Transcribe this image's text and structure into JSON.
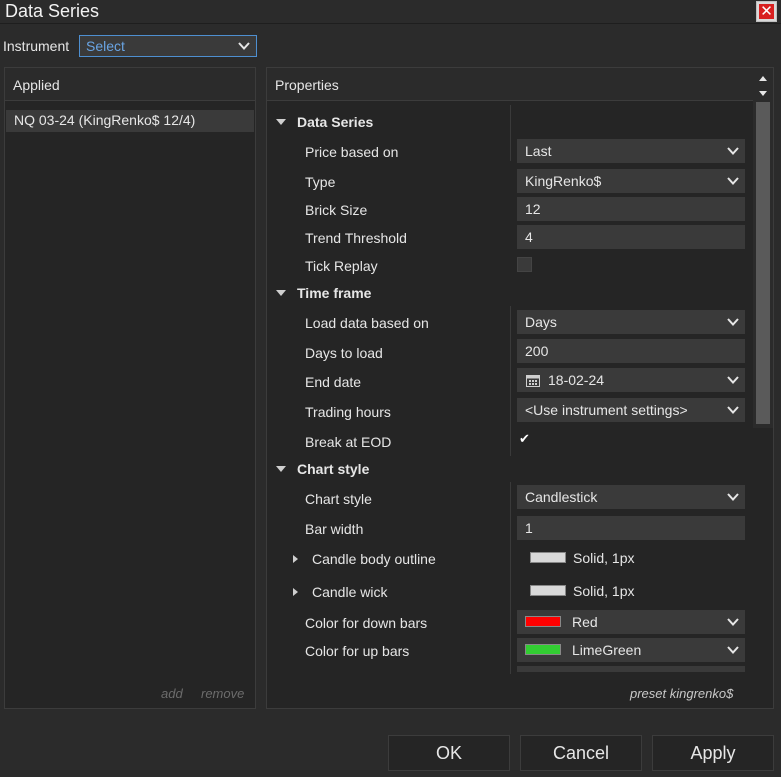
{
  "window": {
    "title": "Data Series"
  },
  "instrument": {
    "label": "Instrument",
    "value": "Select"
  },
  "applied": {
    "header": "Applied",
    "items": [
      "NQ 03-24 (KingRenko$ 12/4)"
    ],
    "add_label": "add",
    "remove_label": "remove"
  },
  "properties": {
    "header": "Properties",
    "data_series": {
      "title": "Data Series",
      "price_based_on": {
        "label": "Price based on",
        "value": "Last"
      },
      "type": {
        "label": "Type",
        "value": "KingRenko$"
      },
      "brick_size": {
        "label": "Brick Size",
        "value": "12"
      },
      "trend_threshold": {
        "label": "Trend Threshold",
        "value": "4"
      },
      "tick_replay": {
        "label": "Tick Replay",
        "checked": false
      }
    },
    "time_frame": {
      "title": "Time frame",
      "load_data_based_on": {
        "label": "Load data based on",
        "value": "Days"
      },
      "days_to_load": {
        "label": "Days to load",
        "value": "200"
      },
      "end_date": {
        "label": "End date",
        "value": "18-02-24"
      },
      "trading_hours": {
        "label": "Trading hours",
        "value": "<Use instrument settings>"
      },
      "break_at_eod": {
        "label": "Break at EOD",
        "checked": true
      }
    },
    "chart_style": {
      "title": "Chart style",
      "chart_style": {
        "label": "Chart style",
        "value": "Candlestick"
      },
      "bar_width": {
        "label": "Bar width",
        "value": "1"
      },
      "candle_body_outline": {
        "label": "Candle body outline",
        "value": "Solid, 1px",
        "color": "#d9d9d9"
      },
      "candle_wick": {
        "label": "Candle wick",
        "value": "Solid, 1px",
        "color": "#d9d9d9"
      },
      "color_down_bars": {
        "label": "Color for down bars",
        "value": "Red",
        "color": "#ff0000"
      },
      "color_up_bars": {
        "label": "Color for up bars",
        "value": "LimeGreen",
        "color": "#32cd32"
      }
    },
    "preset_label": "preset kingrenko$"
  },
  "buttons": {
    "ok": "OK",
    "cancel": "Cancel",
    "apply": "Apply"
  },
  "colors": {
    "accent": "#4e8fd0",
    "close": "#d82020",
    "background": "#2b2b2b"
  }
}
